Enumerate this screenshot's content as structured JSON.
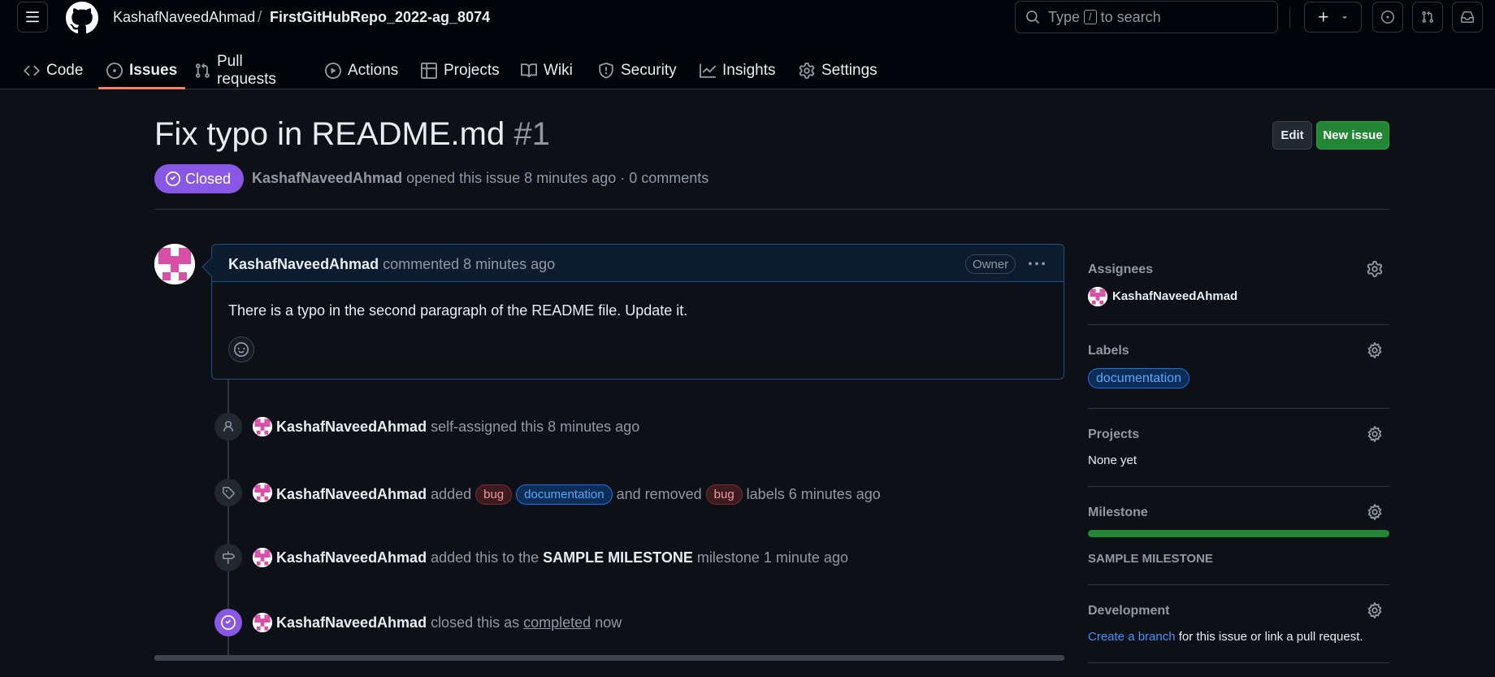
{
  "header": {
    "owner": "KashafNaveedAhmad",
    "separator": "/",
    "repo": "FirstGitHubRepo_2022-ag_8074",
    "search": {
      "prefix": "Type",
      "key": "/",
      "suffix": "to search"
    }
  },
  "tabs": [
    {
      "label": "Code"
    },
    {
      "label": "Issues"
    },
    {
      "label": "Pull requests"
    },
    {
      "label": "Actions"
    },
    {
      "label": "Projects"
    },
    {
      "label": "Wiki"
    },
    {
      "label": "Security"
    },
    {
      "label": "Insights"
    },
    {
      "label": "Settings"
    }
  ],
  "issue": {
    "title": "Fix typo in README.md",
    "number": "#1",
    "state": "Closed",
    "author": "KashafNaveedAhmad",
    "meta_rest": "opened this issue 8 minutes ago · 0 comments",
    "edit_label": "Edit",
    "new_issue_label": "New issue"
  },
  "comment": {
    "author": "KashafNaveedAhmad",
    "when": "commented 8 minutes ago",
    "role": "Owner",
    "body": "There is a typo in the second paragraph of the README file. Update it."
  },
  "timeline": {
    "assign": {
      "actor": "KashafNaveedAhmad",
      "text": "self-assigned this 8 minutes ago"
    },
    "labels": {
      "actor": "KashafNaveedAhmad",
      "added": "added",
      "label1": "bug",
      "label2": "documentation",
      "removed": "and removed",
      "label3": "bug",
      "tail": "labels 6 minutes ago"
    },
    "milestone": {
      "actor": "KashafNaveedAhmad",
      "pre": "added this to the",
      "name": "SAMPLE MILESTONE",
      "post": "milestone 1 minute ago"
    },
    "closed": {
      "actor": "KashafNaveedAhmad",
      "pre": "closed this as",
      "reason": "completed",
      "post": "now"
    }
  },
  "sidebar": {
    "assignees": {
      "heading": "Assignees",
      "value": "KashafNaveedAhmad"
    },
    "labels": {
      "heading": "Labels",
      "value": "documentation"
    },
    "projects": {
      "heading": "Projects",
      "value": "None yet"
    },
    "milestone": {
      "heading": "Milestone",
      "value": "SAMPLE MILESTONE",
      "progress": 1.0
    },
    "development": {
      "heading": "Development",
      "link": "Create a branch",
      "rest": "for this issue or link a pull request."
    }
  },
  "colors": {
    "closed": "#8957e5",
    "primary": "#238636",
    "label_bug": "#f19aa0",
    "label_documentation": "#58a6ff",
    "tab_underline": "#f78166"
  },
  "icons": [
    "hamburger-icon",
    "github-logo-icon",
    "search-icon",
    "plus-icon",
    "chevron-down-icon",
    "issue-icon",
    "pull-request-icon",
    "inbox-icon",
    "code-icon",
    "play-icon",
    "table-icon",
    "book-icon",
    "shield-icon",
    "graph-icon",
    "gear-icon",
    "check-circle-icon",
    "kebab-icon",
    "smiley-icon",
    "person-icon",
    "tag-icon",
    "milestone-icon"
  ]
}
